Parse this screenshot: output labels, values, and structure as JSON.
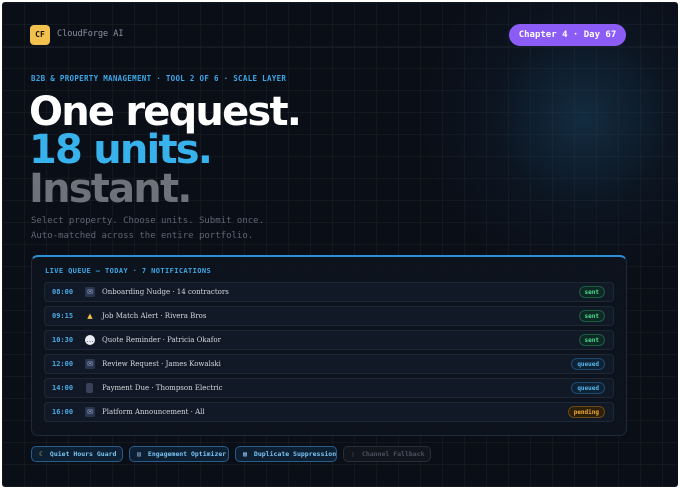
{
  "brand": {
    "badge": "CF",
    "name": "CloudForge AI"
  },
  "chapter": "Chapter 4 · Day 67",
  "hero": {
    "eyebrow": "B2B & PROPERTY MANAGEMENT · TOOL 2 OF 6 · SCALE LAYER",
    "line1": "One request.",
    "line2": "18 units.",
    "line3": "Instant.",
    "sub1": "Select property. Choose units. Submit once.",
    "sub2": "Auto-matched across the entire portfolio."
  },
  "queue": {
    "title": "LIVE QUEUE — TODAY · 7 NOTIFICATIONS",
    "rows": [
      {
        "time": "08:00",
        "icon": "mail-icon",
        "label": "Onboarding Nudge · 14 contractors",
        "status": "sent"
      },
      {
        "time": "09:15",
        "icon": "bell-icon",
        "label": "Job Match Alert · Rivera Bros",
        "status": "sent"
      },
      {
        "time": "10:30",
        "icon": "chat-icon",
        "label": "Quote Reminder · Patricia Okafor",
        "status": "sent"
      },
      {
        "time": "12:00",
        "icon": "mail-icon",
        "label": "Review Request · James Kowalski",
        "status": "queued"
      },
      {
        "time": "14:00",
        "icon": "phone-icon",
        "label": "Payment Due · Thompson Electric",
        "status": "queued"
      },
      {
        "time": "16:00",
        "icon": "mail-icon",
        "label": "Platform Announcement · All",
        "status": "pending"
      }
    ]
  },
  "chips": [
    {
      "icon": "moon-icon",
      "label": "Quiet Hours Guard",
      "active": true
    },
    {
      "icon": "chart-icon",
      "label": "Engagement Optimizer",
      "active": true
    },
    {
      "icon": "copy-icon",
      "label": "Duplicate Suppression",
      "active": true
    },
    {
      "icon": "phone-icon",
      "label": "Channel Fallback",
      "active": false
    }
  ],
  "colors": {
    "accent_blue": "#38b2ec",
    "pill_purple": "#8b5cf6",
    "logo_yellow": "#f2c14e",
    "status_sent": "#4ade9a",
    "status_queued": "#5ab8f0",
    "status_pending": "#f0a83a"
  }
}
